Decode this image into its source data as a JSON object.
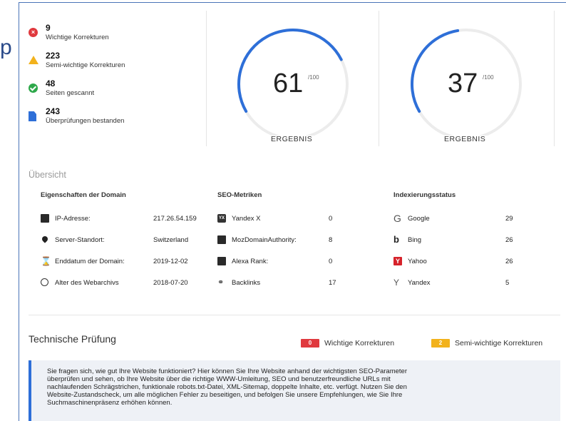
{
  "summary": {
    "items": [
      {
        "value": "9",
        "label": "Wichtige Korrekturen",
        "icon": "error-icon"
      },
      {
        "value": "223",
        "label": "Semi-wichtige Korrekturen",
        "icon": "warning-icon"
      },
      {
        "value": "48",
        "label": "Seiten gescannt",
        "icon": "check-icon"
      },
      {
        "value": "243",
        "label": "Überprüfungen bestanden",
        "icon": "document-icon"
      }
    ]
  },
  "gauges": [
    {
      "score": "61",
      "max": "/100",
      "caption": "ERGEBNIS",
      "fraction": 0.61
    },
    {
      "score": "37",
      "max": "/100",
      "caption": "ERGEBNIS",
      "fraction": 0.37
    }
  ],
  "overview": {
    "title": "Übersicht",
    "domain": {
      "heading": "Eigenschaften der Domain",
      "rows": [
        {
          "label": "IP-Adresse:",
          "value": "217.26.54.159",
          "icon": "server-icon"
        },
        {
          "label": "Server-Standort:",
          "value": "Switzerland",
          "icon": "location-pin-icon"
        },
        {
          "label": "Enddatum der Domain:",
          "value": "2019-12-02",
          "icon": "hourglass-icon"
        },
        {
          "label": "Alter des Webarchivs",
          "value": "2018-07-20",
          "icon": "clock-icon"
        }
      ]
    },
    "seo": {
      "heading": "SEO-Metriken",
      "rows": [
        {
          "label": "Yandex X",
          "value": "0",
          "icon": "yandex-x-icon"
        },
        {
          "label": "MozDomainAuthority:",
          "value": "8",
          "icon": "moz-icon"
        },
        {
          "label": "Alexa Rank:",
          "value": "0",
          "icon": "alexa-icon"
        },
        {
          "label": "Backlinks",
          "value": "17",
          "icon": "link-icon"
        }
      ]
    },
    "index": {
      "heading": "Indexierungsstatus",
      "rows": [
        {
          "label": "Google",
          "value": "29",
          "icon": "google-icon"
        },
        {
          "label": "Bing",
          "value": "26",
          "icon": "bing-icon"
        },
        {
          "label": "Yahoo",
          "value": "26",
          "icon": "yahoo-icon"
        },
        {
          "label": "Yandex",
          "value": "5",
          "icon": "yandex-icon"
        }
      ]
    }
  },
  "technical": {
    "title": "Technische Prüfung",
    "badge_important": "0",
    "label_important": "Wichtige Korrekturen",
    "badge_semi": "2",
    "label_semi": "Semi-wichtige Korrekturen",
    "info_lines": [
      "Sie fragen sich, wie gut Ihre Website funktioniert? Hier können Sie Ihre Website anhand der wichtigsten SEO-Parameter",
      "überprüfen und sehen, ob Ihre Website über die richtige WWW-Umleitung, SEO und benutzerfreundliche URLs mit",
      "nachlaufenden Schrägstrichen, funktionale robots.txt-Datei, XML-Sitemap, doppelte Inhalte, etc. verfügt. Nutzen Sie den",
      "Website-Zustandscheck, um alle möglichen Fehler zu beseitigen, und befolgen Sie unsere Empfehlungen, wie Sie Ihre",
      "Suchmaschinenpräsenz erhöhen können."
    ]
  },
  "partial_letter": "p",
  "colors": {
    "accent": "#2e6fd8",
    "error": "#e0393e",
    "warning": "#f2b21c",
    "success": "#2ea84a"
  }
}
